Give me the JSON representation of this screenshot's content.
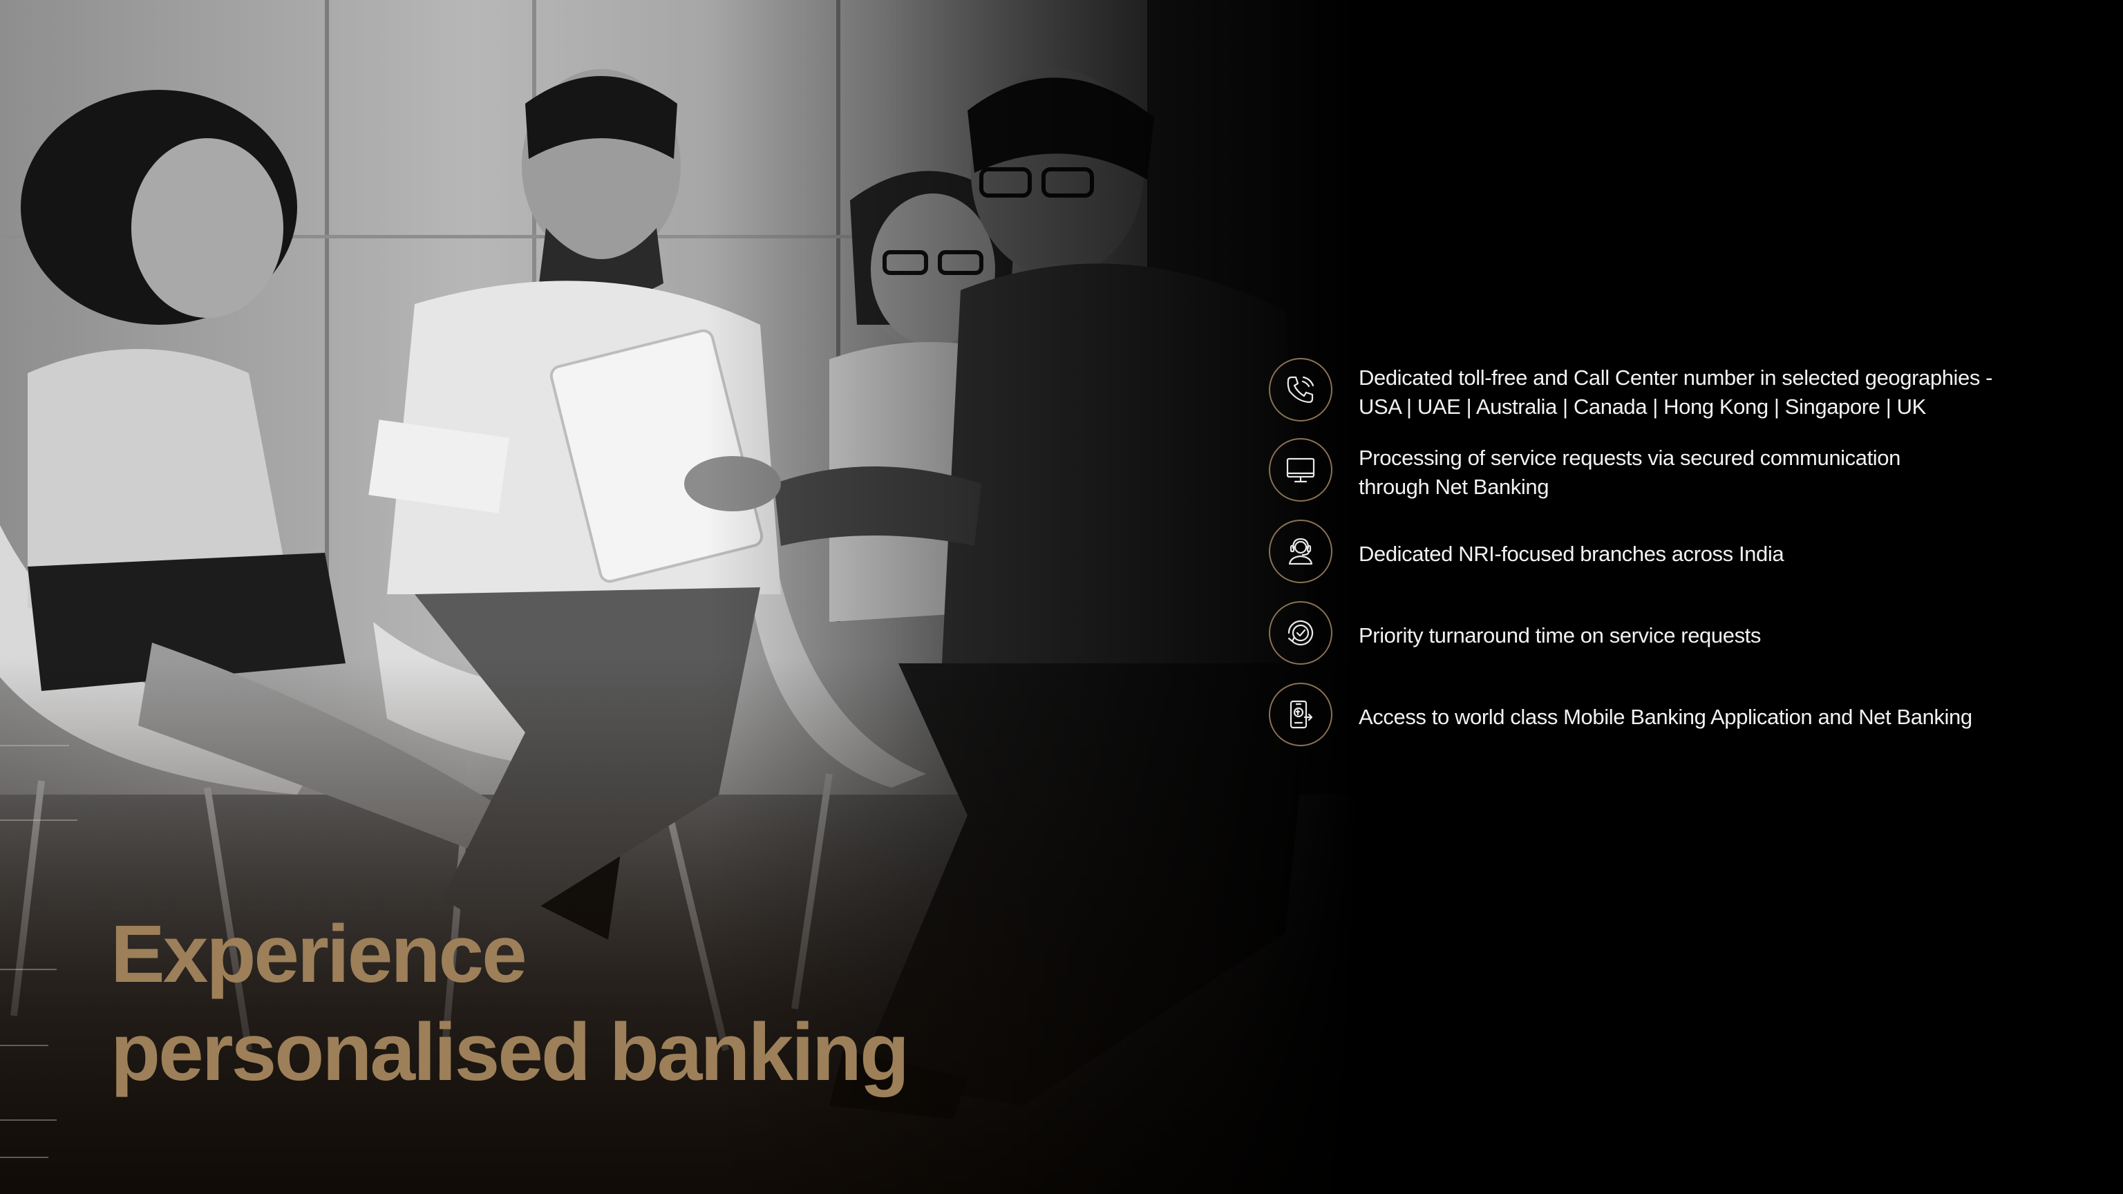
{
  "headline": {
    "line1": "Experience",
    "line2": "personalised banking"
  },
  "features": [
    {
      "icon": "phone-call-icon",
      "line1": "Dedicated toll-free and Call Center number in selected geographies -",
      "line2": "USA | UAE | Australia | Canada | Hong Kong | Singapore | UK"
    },
    {
      "icon": "monitor-icon",
      "line1": "Processing of service requests via secured communication",
      "line2": "through Net Banking"
    },
    {
      "icon": "headset-agent-icon",
      "line1": "Dedicated NRI-focused branches across India",
      "line2": ""
    },
    {
      "icon": "clock-check-icon",
      "line1": "Priority turnaround time on service requests",
      "line2": ""
    },
    {
      "icon": "mobile-banking-icon",
      "line1": "Access to world class Mobile Banking Application and Net Banking",
      "line2": ""
    }
  ],
  "colors": {
    "background": "#000000",
    "headline_gold": "#9d8059",
    "icon_ring_gold": "#8a7253",
    "feature_text": "#f2f2f2"
  }
}
